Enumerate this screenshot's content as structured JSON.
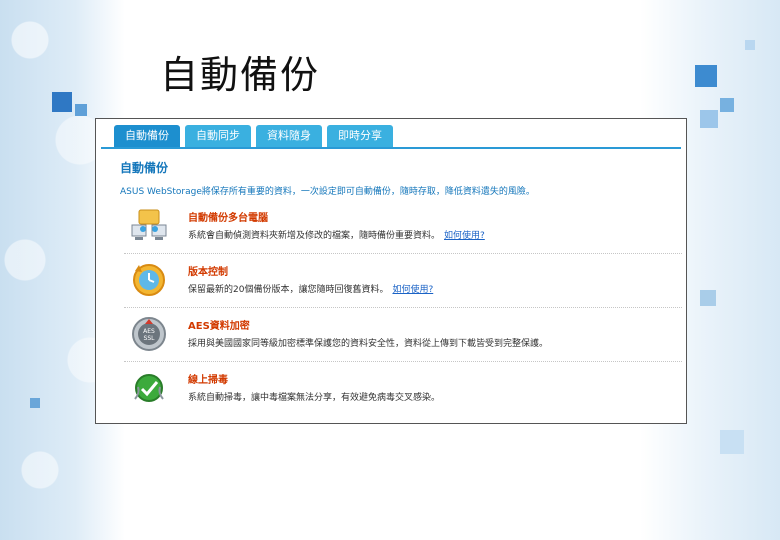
{
  "title": "自動備份",
  "tabs": [
    {
      "label": "自動備份",
      "active": true
    },
    {
      "label": "自動同步",
      "active": false
    },
    {
      "label": "資料隨身",
      "active": false
    },
    {
      "label": "即時分享",
      "active": false
    }
  ],
  "section": {
    "heading": "自動備份",
    "description": "ASUS WebStorage將保存所有重要的資料，一次設定即可自動備份，隨時存取，降低資料遺失的風險。"
  },
  "features": [
    {
      "icon": "folder-computers-icon",
      "title": "自動備份多台電腦",
      "desc": "系統會自動偵測資料夾新增及修改的檔案，隨時備份重要資料。",
      "link": "如何使用?"
    },
    {
      "icon": "version-clock-icon",
      "title": "版本控制",
      "desc": "保留最新的20個備份版本，讓您隨時回復舊資料。",
      "link": "如何使用?"
    },
    {
      "icon": "aes-lock-icon",
      "title": "AES資料加密",
      "desc": "採用與美國國家同等級加密標準保護您的資料安全性，資料從上傳到下載皆受到完整保護。",
      "link": ""
    },
    {
      "icon": "antivirus-scan-icon",
      "title": "線上掃毒",
      "desc": "系統自動掃毒，讓中毒檔案無法分享，有效避免病毒交叉感染。",
      "link": ""
    }
  ],
  "colors": {
    "tab": "#3ab0e0",
    "tab_active": "#1d8fcf",
    "heading": "#1577bb",
    "feature_title": "#d23a00",
    "link": "#1b63c6"
  }
}
